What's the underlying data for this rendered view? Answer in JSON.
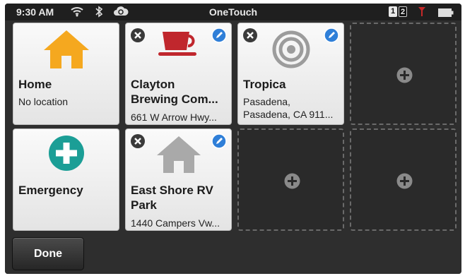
{
  "status_bar": {
    "time": "9:30 AM",
    "title": "OneTouch",
    "page_1": "1",
    "page_2": "2"
  },
  "tiles": [
    {
      "name": "Home",
      "sub": "No location",
      "icon": "house-icon",
      "color": "#f5a623"
    },
    {
      "name": "Clayton\nBrewing Com...",
      "sub": "661 W Arrow Hwy...",
      "icon": "coffee-cup-icon",
      "color": "#c0272d"
    },
    {
      "name": "Tropica",
      "sub": "Pasadena,\nPasadena, CA 911...",
      "icon": "target-icon",
      "color": "#9a9a9a"
    },
    {
      "name": "Emergency",
      "sub": "",
      "icon": "cross-icon",
      "color": "#1b9e96"
    },
    {
      "name": "East Shore RV\nPark",
      "sub": "1440 Campers Vw...",
      "icon": "house-icon",
      "color": "#a8a8a8"
    }
  ],
  "done_label": "Done",
  "colors": {
    "background": "#2e2e2e",
    "edit_badge": "#2f7fd8"
  }
}
